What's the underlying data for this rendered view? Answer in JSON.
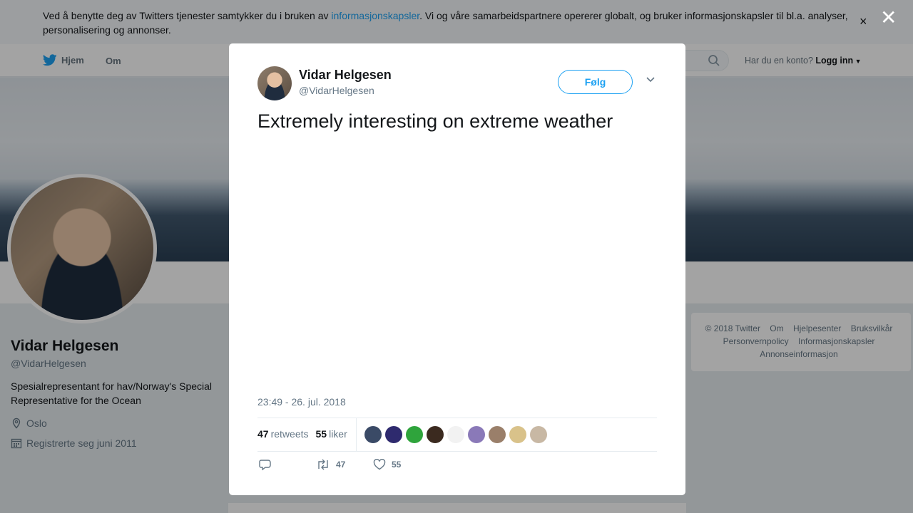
{
  "cookie_bar": {
    "text_before": "Ved å benytte deg av Twitters tjenester samtykker du i bruken av ",
    "link": "informasjonskapsler",
    "text_after": ". Vi og våre samarbeidspartnere opererer globalt, og bruker informasjonskapsler til bl.a. analyser, personalisering og annonser.",
    "close": "×"
  },
  "nav": {
    "home": "Hjem",
    "about": "Om",
    "login_question": "Har du en konto?",
    "login": "Logg inn"
  },
  "profile": {
    "name": "Vidar Helgesen",
    "handle": "@VidarHelgesen",
    "bio": "Spesialrepresentant for hav/Norway's Special Representative for the Ocean",
    "location": "Oslo",
    "joined": "Registrerte seg juni 2011"
  },
  "footer": {
    "links": [
      "© 2018 Twitter",
      "Om",
      "Hjelpesenter",
      "Bruksvilkår",
      "Personvernpolicy",
      "Informasjonskapsler",
      "Annonseinformasjon"
    ]
  },
  "overlay_close": "✕",
  "tweet": {
    "author_name": "Vidar Helgesen",
    "author_handle": "@VidarHelgesen",
    "follow_label": "Følg",
    "text": "Extremely interesting on extreme weather",
    "timestamp": "23:49 - 26. jul. 2018",
    "retweets_count": "47",
    "retweets_label": "retweets",
    "likes_count": "55",
    "likes_label": "liker",
    "action_retweets": "47",
    "action_likes": "55"
  },
  "likers": [
    {
      "color": "#3a4a66"
    },
    {
      "color": "#2e2a6e"
    },
    {
      "color": "#2fa43c"
    },
    {
      "color": "#3b2a1f"
    },
    {
      "color": "#f2f2f2"
    },
    {
      "color": "#8a79b8"
    },
    {
      "color": "#9a7f6a"
    },
    {
      "color": "#d9c28a"
    },
    {
      "color": "#c8b8a4"
    }
  ],
  "colors": {
    "accent": "#1da1f2",
    "text": "#14171a",
    "muted": "#657786"
  }
}
